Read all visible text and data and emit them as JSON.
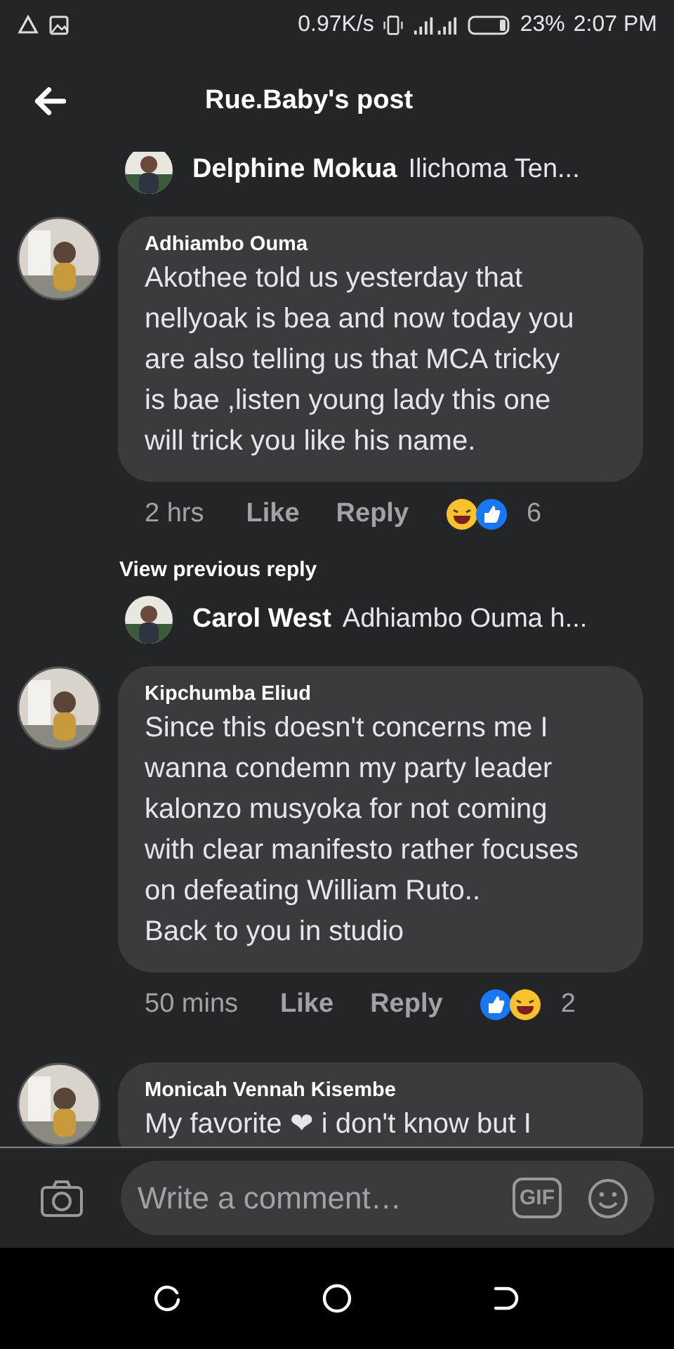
{
  "status_bar": {
    "speed": "0.97K/s",
    "battery": "23%",
    "time": "2:07 PM"
  },
  "header": {
    "title": "Rue.Baby's post"
  },
  "items": [
    {
      "kind": "reply_preview",
      "author": "Delphine Mokua",
      "text": "Ilichoma Ten..."
    },
    {
      "kind": "comment",
      "author": "Adhiambo Ouma",
      "text": "Akothee told us yesterday that nellyoak is bea and now today you are also telling us that MCA tricky is bae ,listen young lady this one will trick you like his name.",
      "time": "2 hrs",
      "like": "Like",
      "reply": "Reply",
      "reactions": [
        {
          "kind": "haha"
        },
        {
          "kind": "like"
        }
      ],
      "count": "6"
    },
    {
      "kind": "view_more",
      "text": "View previous reply"
    },
    {
      "kind": "reply_preview",
      "author": "Carol West",
      "text": "Adhiambo Ouma h..."
    },
    {
      "kind": "comment",
      "author": "Kipchumba Eliud",
      "text": "Since this doesn't concerns me I wanna condemn my party leader kalonzo musyoka for not coming with clear manifesto rather focuses on defeating William Ruto..\nBack to you in studio",
      "time": "50 mins",
      "like": "Like",
      "reply": "Reply",
      "reactions": [
        {
          "kind": "like"
        },
        {
          "kind": "haha"
        }
      ],
      "count": "2"
    },
    {
      "kind": "comment",
      "author": "Monicah Vennah Kisembe",
      "text": "My favorite ❤ i don't know but I"
    }
  ],
  "composer": {
    "placeholder": "Write a comment…",
    "gif": "GIF"
  }
}
